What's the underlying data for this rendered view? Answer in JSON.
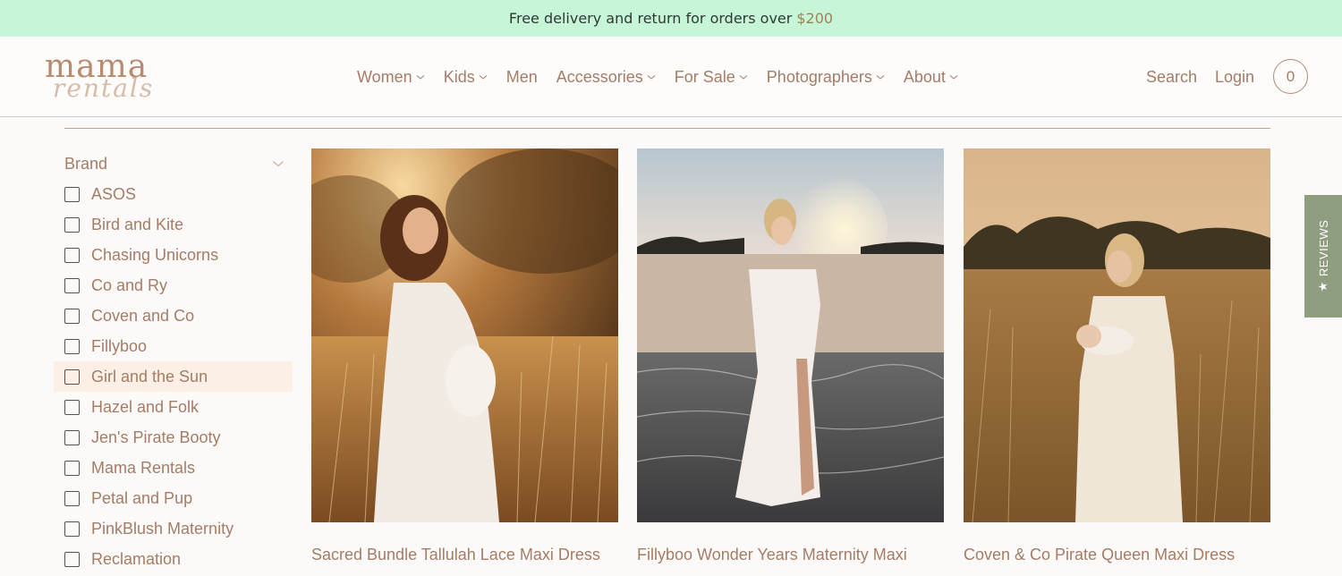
{
  "announcement": {
    "text": "Free delivery and return for orders over",
    "amount": "$200"
  },
  "logo": {
    "line1": "mama",
    "line2": "rentals"
  },
  "nav": [
    {
      "label": "Women",
      "dropdown": true
    },
    {
      "label": "Kids",
      "dropdown": true
    },
    {
      "label": "Men",
      "dropdown": false
    },
    {
      "label": "Accessories",
      "dropdown": true
    },
    {
      "label": "For Sale",
      "dropdown": true
    },
    {
      "label": "Photographers",
      "dropdown": true
    },
    {
      "label": "About",
      "dropdown": true
    }
  ],
  "header_utils": {
    "search": "Search",
    "login": "Login",
    "cart_count": "0"
  },
  "filter": {
    "title": "Brand",
    "brands": [
      "ASOS",
      "Bird and Kite",
      "Chasing Unicorns",
      "Co and Ry",
      "Coven and Co",
      "Fillyboo",
      "Girl and the Sun",
      "Hazel and Folk",
      "Jen's Pirate Booty",
      "Mama Rentals",
      "Petal and Pup",
      "PinkBlush Maternity",
      "Reclamation"
    ],
    "hovered_index": 6
  },
  "products": [
    {
      "title": "Sacred Bundle Tallulah Lace Maxi Dress"
    },
    {
      "title": "Fillyboo Wonder Years Maternity Maxi"
    },
    {
      "title": "Coven & Co Pirate Queen Maxi Dress"
    }
  ],
  "reviews_tab": {
    "star": "★",
    "label": "REVIEWS"
  },
  "colors": {
    "accent": "#a57c66",
    "announce_bg": "#c6f5d8",
    "reviews_bg": "#8f9e7f"
  }
}
